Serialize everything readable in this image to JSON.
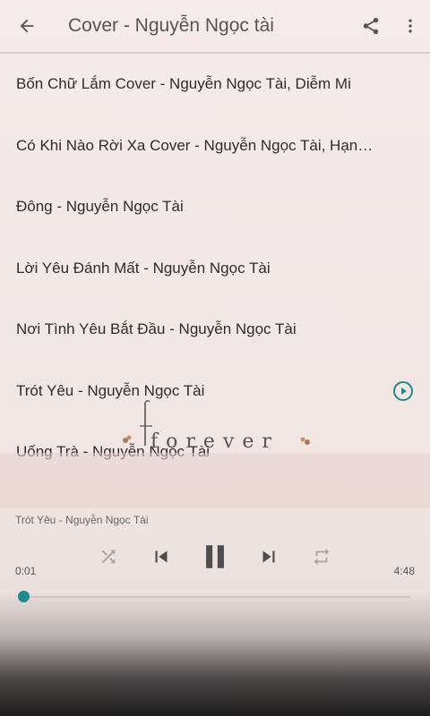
{
  "toolbar": {
    "title": "Cover - Nguyễn Ngọc tài",
    "icons": [
      "back-arrow-icon",
      "share-icon",
      "more-vert-icon"
    ]
  },
  "songs": [
    {
      "title": "Bốn Chữ Lắm Cover - Nguyễn Ngọc Tài, Diễm Mi"
    },
    {
      "title": "Có Khi Nào Rời Xa Cover - Nguyễn Ngọc Tài, Hạnh Khuê"
    },
    {
      "title": "Đông - Nguyễn Ngọc Tài"
    },
    {
      "title": "Lời Yêu Đánh Mất - Nguyễn Ngọc Tài"
    },
    {
      "title": "Nơi Tình Yêu Bắt Đầu - Nguyễn Ngọc Tài"
    },
    {
      "title": "Trót Yêu - Nguyễn Ngọc Tài",
      "playing": true
    },
    {
      "title": "Uống Trà - Nguyễn Ngọc Tài"
    }
  ],
  "background_art": {
    "text": "forever"
  },
  "player": {
    "now_playing": "Trót Yêu - Nguyễn Ngọc Tài",
    "current_time": "0:01",
    "total_time": "4:48",
    "progress": 0.004,
    "accent_color": "#1f8a8a"
  }
}
